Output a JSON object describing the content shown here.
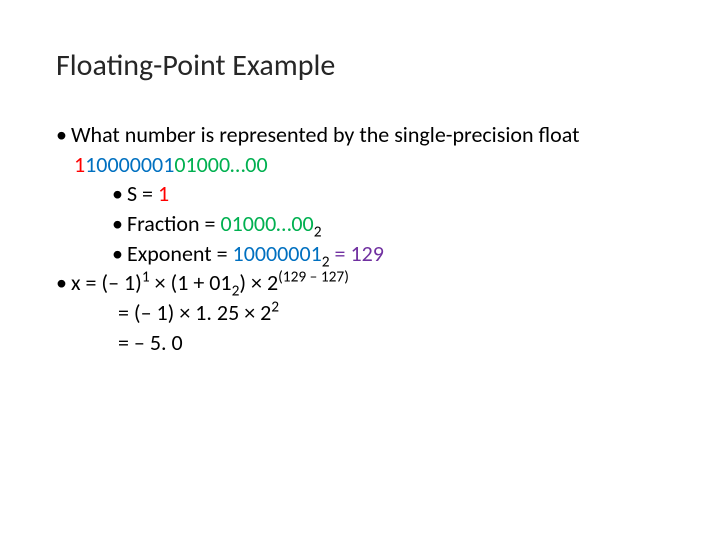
{
  "title": "Floating-Point Example",
  "question": "What number is represented by the single-precision float",
  "bits": {
    "sign": "1",
    "exponent": "10000001",
    "fraction_head": "01000…00"
  },
  "fields": {
    "s_label": "S = ",
    "s_value": "1",
    "fraction_label": "Fraction = ",
    "fraction_value": "01000…00",
    "fraction_base": "2",
    "exponent_label": "Exponent = ",
    "exponent_value": "10000001",
    "exponent_base": "2",
    "exponent_eq": " = 129"
  },
  "calc": {
    "line1_pre": "x = (– 1)",
    "line1_sup1": "1",
    "line1_mid": " × (1 + 01",
    "line1_sub1": "2",
    "line1_mid2": ") × 2",
    "line1_sup2": "(129 – 127)",
    "line2_pre": "= (– 1) × 1. 25 × 2",
    "line2_sup": "2",
    "line3": "= – 5. 0"
  },
  "colors": {
    "sign": "#ff0000",
    "exponent": "#0070c0",
    "fraction": "#00b050",
    "decimal": "#7030a0"
  },
  "bullet": "•"
}
